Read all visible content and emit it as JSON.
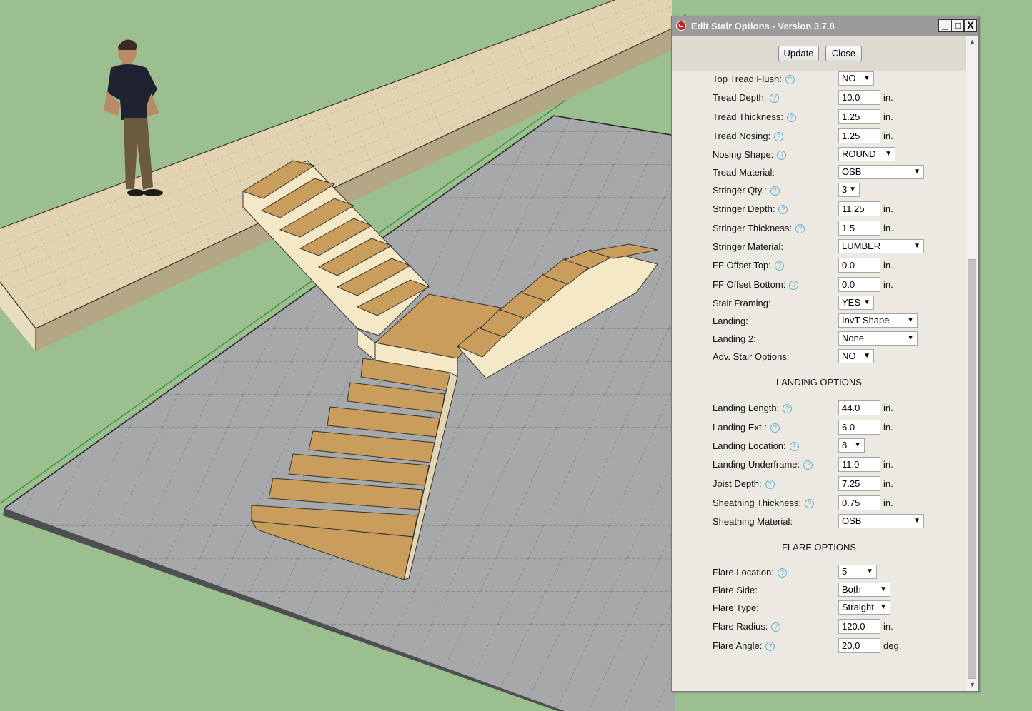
{
  "dialog": {
    "title": "Edit Stair Options - Version 3.7.8",
    "window_buttons": {
      "minimize": "_",
      "maximize": "□",
      "close": "X"
    },
    "update_label": "Update",
    "close_label": "Close"
  },
  "help_glyph": "?",
  "fields": [
    {
      "label": "Top Tread Flush:",
      "help": true,
      "kind": "select",
      "value": "NO",
      "unit": ""
    },
    {
      "label": "Tread Depth:",
      "help": true,
      "kind": "input",
      "value": "10.0",
      "unit": "in."
    },
    {
      "label": "Tread Thickness:",
      "help": true,
      "kind": "input",
      "value": "1.25",
      "unit": "in."
    },
    {
      "label": "Tread Nosing:",
      "help": true,
      "kind": "input",
      "value": "1.25",
      "unit": "in."
    },
    {
      "label": "Nosing Shape:",
      "help": true,
      "kind": "select",
      "value": "ROUND",
      "unit": ""
    },
    {
      "label": "Tread Material:",
      "help": false,
      "kind": "select",
      "value": "OSB",
      "unit": ""
    },
    {
      "label": "Stringer Qty.:",
      "help": true,
      "kind": "select",
      "value": "3",
      "unit": ""
    },
    {
      "label": "Stringer Depth:",
      "help": true,
      "kind": "input",
      "value": "11.25",
      "unit": "in."
    },
    {
      "label": "Stringer Thickness:",
      "help": true,
      "kind": "input",
      "value": "1.5",
      "unit": "in."
    },
    {
      "label": "Stringer Material:",
      "help": false,
      "kind": "select",
      "value": "LUMBER",
      "unit": ""
    },
    {
      "label": "FF Offset Top:",
      "help": true,
      "kind": "input",
      "value": "0.0",
      "unit": "in."
    },
    {
      "label": "FF Offset Bottom:",
      "help": true,
      "kind": "input",
      "value": "0.0",
      "unit": "in."
    },
    {
      "label": "Stair Framing:",
      "help": false,
      "kind": "select",
      "value": "YES",
      "unit": ""
    },
    {
      "label": "Landing:",
      "help": false,
      "kind": "select",
      "value": "InvT-Shape",
      "unit": ""
    },
    {
      "label": "Landing 2:",
      "help": false,
      "kind": "select",
      "value": "None",
      "unit": ""
    },
    {
      "label": "Adv. Stair Options:",
      "help": false,
      "kind": "select",
      "value": "NO",
      "unit": ""
    }
  ],
  "landing_header": "LANDING OPTIONS",
  "landing_fields": [
    {
      "label": "Landing Length:",
      "help": true,
      "kind": "input",
      "value": "44.0",
      "unit": "in."
    },
    {
      "label": "Landing Ext.:",
      "help": true,
      "kind": "input",
      "value": "6.0",
      "unit": "in."
    },
    {
      "label": "Landing Location:",
      "help": true,
      "kind": "select",
      "value": "8",
      "unit": ""
    },
    {
      "label": "Landing Underframe:",
      "help": true,
      "kind": "input",
      "value": "11.0",
      "unit": "in."
    },
    {
      "label": "Joist Depth:",
      "help": true,
      "kind": "input",
      "value": "7.25",
      "unit": "in."
    },
    {
      "label": "Sheathing Thickness:",
      "help": true,
      "kind": "input",
      "value": "0.75",
      "unit": "in."
    },
    {
      "label": "Sheathing Material:",
      "help": false,
      "kind": "select",
      "value": "OSB",
      "unit": ""
    }
  ],
  "flare_header": "FLARE OPTIONS",
  "flare_fields": [
    {
      "label": "Flare Location:",
      "help": true,
      "kind": "select",
      "value": "5",
      "unit": ""
    },
    {
      "label": "Flare Side:",
      "help": false,
      "kind": "select",
      "value": "Both",
      "unit": ""
    },
    {
      "label": "Flare Type:",
      "help": false,
      "kind": "select",
      "value": "Straight",
      "unit": ""
    },
    {
      "label": "Flare Radius:",
      "help": true,
      "kind": "input",
      "value": "120.0",
      "unit": "in."
    },
    {
      "label": "Flare Angle:",
      "help": true,
      "kind": "input",
      "value": "20.0",
      "unit": "deg."
    }
  ],
  "colors": {
    "sky_ground": "#9bbf8e",
    "floor": "#a7a9ab",
    "wall_top": "#e4d6b3",
    "tread": "#c99e5c",
    "stringer": "#f4e8c6",
    "titlebar": "#9b9b9b",
    "dialog_bg": "#ece9e3"
  }
}
